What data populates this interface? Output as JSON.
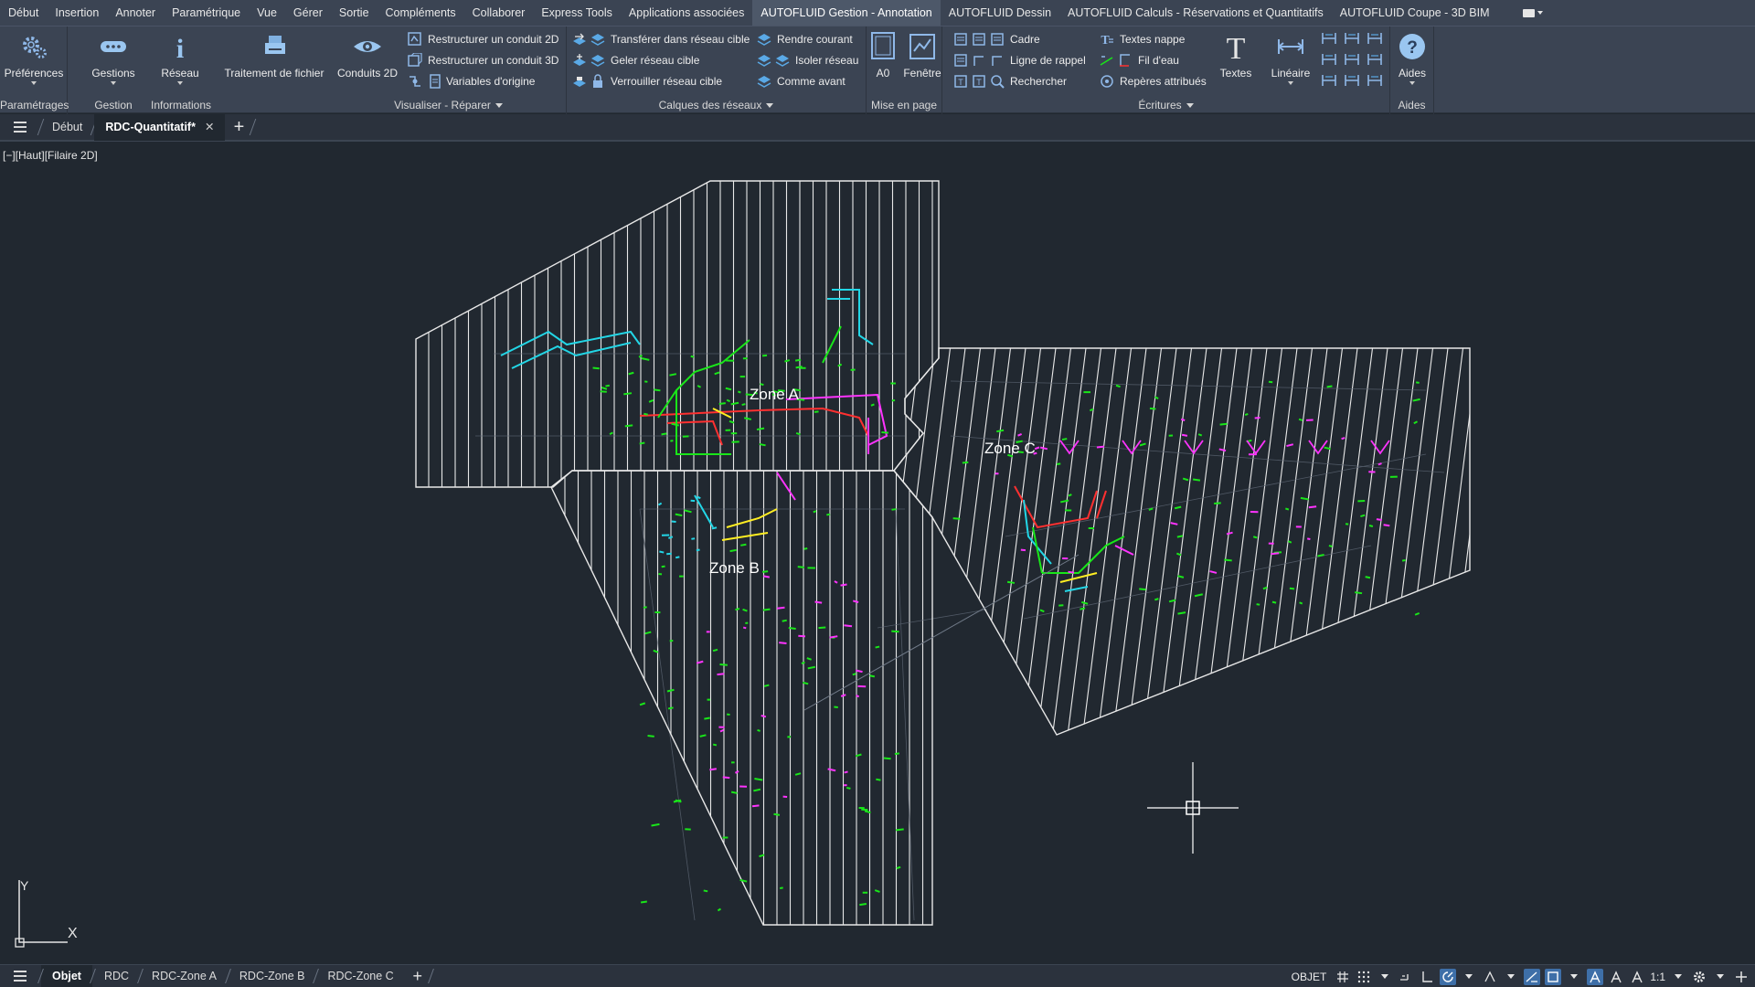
{
  "menu": {
    "items": [
      "Début",
      "Insertion",
      "Annoter",
      "Paramétrique",
      "Vue",
      "Gérer",
      "Sortie",
      "Compléments",
      "Collaborer",
      "Express Tools",
      "Applications associées",
      "AUTOFLUID Gestion - Annotation",
      "AUTOFLUID Dessin",
      "AUTOFLUID Calculs - Réservations et Quantitatifs",
      "AUTOFLUID Coupe - 3D BIM"
    ],
    "active_index": 11
  },
  "ribbon": {
    "preferences_label": "Préférences",
    "gestions_label": "Gestions",
    "reseau_label": "Réseau",
    "traitement_label": "Traitement de fichier",
    "conduits2d_label": "Conduits 2D",
    "restructurer2d_label": "Restructurer un conduit 2D",
    "restructurer3d_label": "Restructurer un conduit 3D",
    "variables_label": "Variables d'origine",
    "transferer_label": "Transférer dans réseau cible",
    "geler_label": "Geler réseau cible",
    "verrouiller_label": "Verrouiller réseau cible",
    "rendre_courant_label": "Rendre courant",
    "isoler_label": "Isoler réseau",
    "comme_avant_label": "Comme avant",
    "a0_label": "A0",
    "fenetre_label": "Fenêtre",
    "cadre_label": "Cadre",
    "ligne_rappel_label": "Ligne de rappel",
    "rechercher_label": "Rechercher",
    "textes_nappe_label": "Textes nappe",
    "fil_eau_label": "Fil d'eau",
    "reperes_label": "Repères attribués",
    "textes_label": "Textes",
    "lineaire_label": "Linéaire",
    "aides_label": "Aides",
    "panels": {
      "parametrages": "Paramétrages",
      "gestion": "Gestion",
      "informations": "Informations",
      "visualiser": "Visualiser - Réparer",
      "calques": "Calques des réseaux",
      "mise_en_page": "Mise en page",
      "ecritures": "Écritures",
      "aides": "Aides"
    }
  },
  "tabs": {
    "debut": "Début",
    "active": "RDC-Quantitatif*",
    "close": "✕",
    "plus": "+"
  },
  "viewport": {
    "label": "[−][Haut][Filaire 2D]",
    "zones": [
      "Zone A",
      "Zone B",
      "Zone C"
    ],
    "ucs_x": "X",
    "ucs_y": "Y"
  },
  "status": {
    "layouts": [
      "Objet",
      "RDC",
      "RDC-Zone A",
      "RDC-Zone B",
      "RDC-Zone C"
    ],
    "active_index": 0,
    "plus": "+",
    "mode": "OBJET",
    "scale": "1:1"
  },
  "colors": {
    "bg": "#212830",
    "ribbon": "#3b4453",
    "hatch": "#e8e8e8",
    "net_green": "#19e619",
    "net_magenta": "#ff33ff",
    "net_cyan": "#22d6e6",
    "net_red": "#ff3030",
    "net_yellow": "#ffee22",
    "accent": "#3e6fa8"
  }
}
